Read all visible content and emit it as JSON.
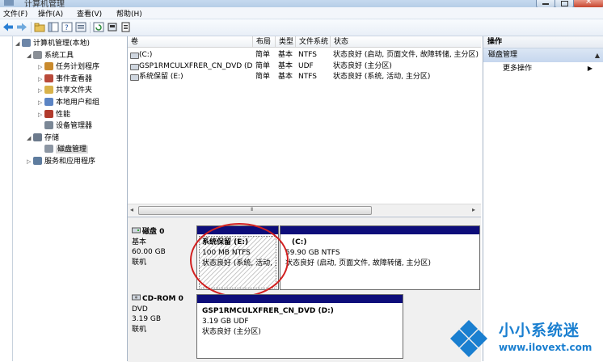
{
  "window": {
    "title": "计算机管理"
  },
  "menu": [
    "文件(F)",
    "操作(A)",
    "查看(V)",
    "帮助(H)"
  ],
  "tree": [
    {
      "label": "计算机管理(本地)",
      "icon": "computer-icon",
      "indent": 0,
      "expander": "expanded"
    },
    {
      "label": "系统工具",
      "icon": "tools-icon",
      "indent": 1,
      "expander": "expanded"
    },
    {
      "label": "任务计划程序",
      "icon": "clock-icon",
      "indent": 2,
      "expander": "collapsed"
    },
    {
      "label": "事件查看器",
      "icon": "event-viewer-icon",
      "indent": 2,
      "expander": "collapsed"
    },
    {
      "label": "共享文件夹",
      "icon": "shared-folder-icon",
      "indent": 2,
      "expander": "collapsed"
    },
    {
      "label": "本地用户和组",
      "icon": "users-icon",
      "indent": 2,
      "expander": "collapsed"
    },
    {
      "label": "性能",
      "icon": "performance-icon",
      "indent": 2,
      "expander": "collapsed"
    },
    {
      "label": "设备管理器",
      "icon": "device-manager-icon",
      "indent": 2,
      "expander": "none"
    },
    {
      "label": "存储",
      "icon": "storage-icon",
      "indent": 1,
      "expander": "expanded"
    },
    {
      "label": "磁盘管理",
      "icon": "disk-management-icon",
      "indent": 2,
      "expander": "none",
      "selected": true
    },
    {
      "label": "服务和应用程序",
      "icon": "services-icon",
      "indent": 1,
      "expander": "collapsed"
    }
  ],
  "volumes": {
    "columns": [
      "卷",
      "布局",
      "类型",
      "文件系统",
      "状态"
    ],
    "rows": [
      [
        "(C:)",
        "简单",
        "基本",
        "NTFS",
        "状态良好 (启动, 页面文件, 故障转储, 主分区)"
      ],
      [
        "GSP1RMCULXFRER_CN_DVD (D:)",
        "简单",
        "基本",
        "UDF",
        "状态良好 (主分区)"
      ],
      [
        "系统保留 (E:)",
        "简单",
        "基本",
        "NTFS",
        "状态良好 (系统, 活动, 主分区)"
      ]
    ],
    "scroll_arrow": "III"
  },
  "disks": [
    {
      "name": "磁盘 0",
      "type": "基本",
      "size": "60.00 GB",
      "status": "联机",
      "partitions": [
        {
          "name": "系统保留  (E:)",
          "size": "100 MB NTFS",
          "status": "状态良好 (系统, 活动, 主"
        },
        {
          "name": "(C:)",
          "size": "59.90 GB NTFS",
          "status": "状态良好 (启动, 页面文件, 故障转储, 主分区)"
        }
      ]
    },
    {
      "name": "CD-ROM 0",
      "type": "DVD",
      "size": "3.19 GB",
      "status": "联机",
      "partitions": [
        {
          "name": "GSP1RMCULXFRER_CN_DVD  (D:)",
          "size": "3.19 GB UDF",
          "status": "状态良好 (主分区)"
        }
      ]
    }
  ],
  "actions": {
    "header": "操作",
    "section": "磁盘管理",
    "more": "更多操作"
  },
  "watermark": {
    "brand": "小小系统迷",
    "url": "www.ilovext.com"
  },
  "colors": {
    "partition_bar": "#0d0d7a",
    "highlight_circle": "#d22020",
    "watermark_blue": "#1a7fd0"
  }
}
